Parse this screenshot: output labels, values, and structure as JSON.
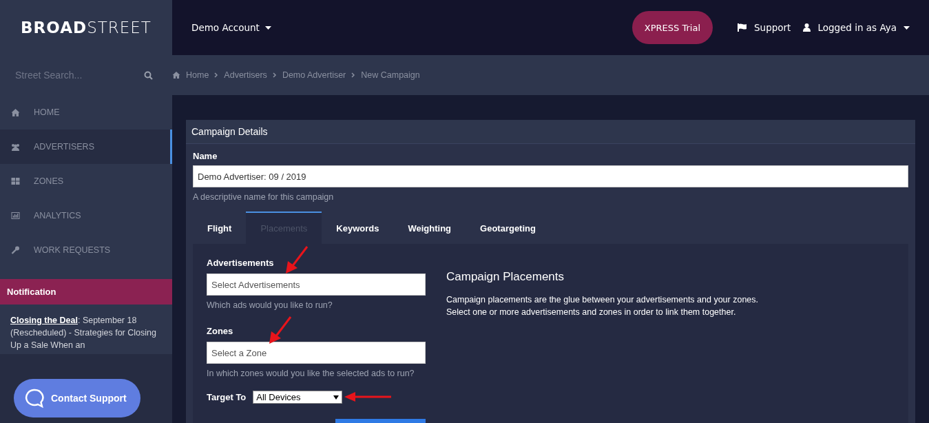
{
  "brand": {
    "bold": "BROAD",
    "light": "STREET"
  },
  "topbar": {
    "account": "Demo Account",
    "trial_button": "XPRESS Trial",
    "support": "Support",
    "user": "Logged in as Aya"
  },
  "sidebar": {
    "search": {
      "placeholder": "Street Search..."
    },
    "items": [
      {
        "label": "HOME",
        "kind": "home",
        "selected": false
      },
      {
        "label": "ADVERTISERS",
        "kind": "users",
        "selected": true
      },
      {
        "label": "ZONES",
        "kind": "grid",
        "selected": false
      },
      {
        "label": "ANALYTICS",
        "kind": "chart",
        "selected": false
      },
      {
        "label": "WORK REQUESTS",
        "kind": "wrench",
        "selected": false
      }
    ],
    "notification": {
      "title": "Notification",
      "link": "Closing the Deal",
      "text": ": September 18 (Rescheduled) - Strategies for Closing Up a Sale When an"
    },
    "contact_button": "Contact Support"
  },
  "breadcrumb": [
    "Home",
    "Advertisers",
    "Demo Advertiser",
    "New Campaign"
  ],
  "card": {
    "title": "Campaign Details",
    "name_label": "Name",
    "name_value": "Demo Advertiser: 09 / 2019",
    "name_help": "A descriptive name for this campaign",
    "tabs": [
      {
        "label": "Flight",
        "selected": false
      },
      {
        "label": "Placements",
        "selected": true
      },
      {
        "label": "Keywords",
        "selected": false
      },
      {
        "label": "Weighting",
        "selected": false
      },
      {
        "label": "Geotargeting",
        "selected": false
      }
    ],
    "fields": [
      {
        "label": "Advertisements",
        "placeholder": "Select Advertisements",
        "help": "Which ads would you like to run?"
      },
      {
        "label": "Zones",
        "placeholder": "Select a Zone",
        "help": "In which zones would you like the selected ads to run?"
      }
    ],
    "target": {
      "label": "Target To",
      "value": "All Devices"
    },
    "info": {
      "title": "Campaign Placements",
      "text": "Campaign placements are the glue between your advertisements and your zones. Select one or more advertisements and zones in order to link them together."
    }
  },
  "annotations": [
    {
      "kind": "diagonal"
    },
    {
      "kind": "diagonal"
    },
    {
      "kind": "horizontal"
    }
  ]
}
